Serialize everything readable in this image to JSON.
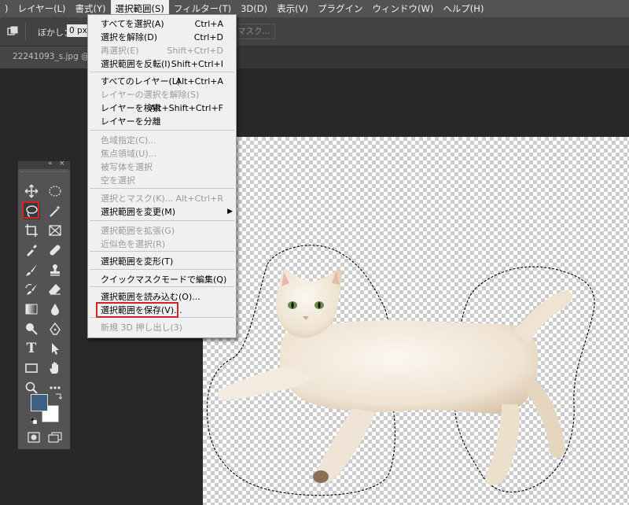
{
  "menubar": {
    "items": [
      {
        "label": ")"
      },
      {
        "label": "レイヤー(L)"
      },
      {
        "label": "書式(Y)"
      },
      {
        "label": "選択範囲(S)",
        "active": true
      },
      {
        "label": "フィルター(T)"
      },
      {
        "label": "3D(D)"
      },
      {
        "label": "表示(V)"
      },
      {
        "label": "プラグイン"
      },
      {
        "label": "ウィンドウ(W)"
      },
      {
        "label": "ヘルプ(H)"
      }
    ]
  },
  "options": {
    "feather_label": "ぼかし：",
    "feather_value": "0 px",
    "mask_button": "マスク..."
  },
  "document": {
    "tab_title": "22241093_s.jpg @ 1"
  },
  "select_menu": {
    "items": [
      {
        "label": "すべてを選択(A)",
        "shortcut": "Ctrl+A",
        "enabled": true
      },
      {
        "label": "選択を解除(D)",
        "shortcut": "Ctrl+D",
        "enabled": true
      },
      {
        "label": "再選択(E)",
        "shortcut": "Shift+Ctrl+D",
        "enabled": false
      },
      {
        "label": "選択範囲を反転(I)",
        "shortcut": "Shift+Ctrl+I",
        "enabled": true
      },
      {
        "label": "すべてのレイヤー(L)",
        "shortcut": "Alt+Ctrl+A",
        "enabled": true
      },
      {
        "label": "レイヤーの選択を解除(S)",
        "shortcut": "",
        "enabled": false
      },
      {
        "label": "レイヤーを検索",
        "shortcut": "Alt+Shift+Ctrl+F",
        "enabled": true
      },
      {
        "label": "レイヤーを分離",
        "shortcut": "",
        "enabled": true
      },
      {
        "label": "色域指定(C)...",
        "shortcut": "",
        "enabled": false
      },
      {
        "label": "焦点領域(U)...",
        "shortcut": "",
        "enabled": false
      },
      {
        "label": "被写体を選択",
        "shortcut": "",
        "enabled": false
      },
      {
        "label": "空を選択",
        "shortcut": "",
        "enabled": false
      },
      {
        "label": "選択とマスク(K)...",
        "shortcut": "Alt+Ctrl+R",
        "enabled": false
      },
      {
        "label": "選択範囲を変更(M)",
        "shortcut": "",
        "enabled": true,
        "submenu": true
      },
      {
        "label": "選択範囲を拡張(G)",
        "shortcut": "",
        "enabled": false
      },
      {
        "label": "近似色を選択(R)",
        "shortcut": "",
        "enabled": false
      },
      {
        "label": "選択範囲を変形(T)",
        "shortcut": "",
        "enabled": true
      },
      {
        "label": "クイックマスクモードで編集(Q)",
        "shortcut": "",
        "enabled": true
      },
      {
        "label": "選択範囲を読み込む(O)...",
        "shortcut": "",
        "enabled": true
      },
      {
        "label": "選択範囲を保存(V)...",
        "shortcut": "",
        "enabled": true,
        "highlighted": true
      },
      {
        "label": "新規 3D 押し出し(3)",
        "shortcut": "",
        "enabled": false
      }
    ]
  },
  "toolbox": {
    "tools": [
      {
        "name": "move-tool",
        "icon": "move-icon"
      },
      {
        "name": "marquee-tool",
        "icon": "ellipse-marquee-icon"
      },
      {
        "name": "lasso-tool",
        "icon": "lasso-icon",
        "selected": true
      },
      {
        "name": "magic-wand-tool",
        "icon": "magic-wand-icon"
      },
      {
        "name": "crop-tool",
        "icon": "crop-icon"
      },
      {
        "name": "frame-tool",
        "icon": "frame-icon"
      },
      {
        "name": "eyedropper-tool",
        "icon": "eyedropper-icon"
      },
      {
        "name": "healing-brush-tool",
        "icon": "bandage-icon"
      },
      {
        "name": "brush-tool",
        "icon": "brush-icon"
      },
      {
        "name": "clone-stamp-tool",
        "icon": "stamp-icon"
      },
      {
        "name": "history-brush-tool",
        "icon": "history-brush-icon"
      },
      {
        "name": "eraser-tool",
        "icon": "eraser-icon"
      },
      {
        "name": "gradient-tool",
        "icon": "gradient-icon"
      },
      {
        "name": "blur-tool",
        "icon": "drop-icon"
      },
      {
        "name": "dodge-tool",
        "icon": "dodge-icon"
      },
      {
        "name": "pen-tool",
        "icon": "pen-icon"
      },
      {
        "name": "type-tool",
        "icon": "type-icon"
      },
      {
        "name": "path-selection-tool",
        "icon": "arrow-icon"
      },
      {
        "name": "rectangle-tool",
        "icon": "rectangle-icon"
      },
      {
        "name": "hand-tool",
        "icon": "hand-icon"
      },
      {
        "name": "zoom-tool",
        "icon": "zoom-icon"
      },
      {
        "name": "more-tools",
        "icon": "ellipsis-icon"
      }
    ],
    "type_glyph": "T",
    "header_collapse": "«",
    "header_close": "×",
    "foreground_color": "#3d6080",
    "background_color": "#ffffff"
  },
  "colors": {
    "menu_bg": "#535353",
    "options_bg": "#424242",
    "workspace_bg": "#282828",
    "highlight_red": "#d2232a"
  }
}
